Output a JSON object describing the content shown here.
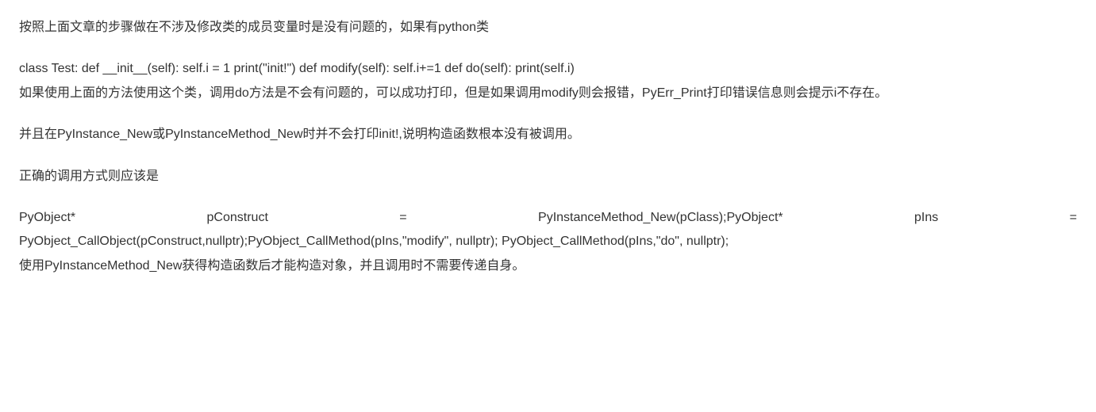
{
  "paragraphs": {
    "p1": "按照上面文章的步骤做在不涉及修改类的成员变量时是没有问题的，如果有python类",
    "p2a": "class Test: def __init__(self): self.i = 1 print(\"init!\") def modify(self): self.i+=1 def do(self): print(self.i)",
    "p2b": "如果使用上面的方法使用这个类，调用do方法是不会有问题的，可以成功打印，但是如果调用modify则会报错，PyErr_Print打印错误信息则会提示i不存在。",
    "p3": "并且在PyInstance_New或PyInstanceMethod_New时并不会打印init!,说明构造函数根本没有被调用。",
    "p4": "正确的调用方式则应该是",
    "p5_line1": "PyObject* pConstruct = PyInstanceMethod_New(pClass);PyObject* pIns =",
    "p5_line2": "PyObject_CallObject(pConstruct,nullptr);PyObject_CallMethod(pIns,\"modify\", nullptr); PyObject_CallMethod(pIns,\"do\", nullptr);",
    "p5_line3": "使用PyInstanceMethod_New获得构造函数后才能构造对象，并且调用时不需要传递自身。"
  }
}
